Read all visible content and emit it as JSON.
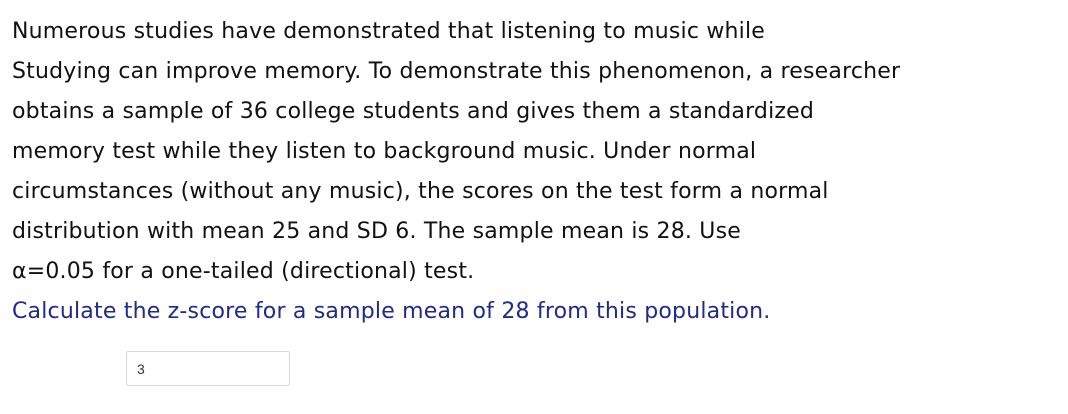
{
  "question": {
    "lines": [
      "Numerous studies have demonstrated that listening to music while",
      "Studying can improve memory. To demonstrate this phenomenon, a researcher",
      "obtains a sample of 36 college students and gives them a standardized",
      "memory test while they listen to background music. Under normal",
      "circumstances (without any music), the scores on the test form a normal",
      "distribution with mean 25 and SD 6. The sample mean is 28. Use",
      "α=0.05 for a one-tailed (directional) test."
    ],
    "prompt": "Calculate the z-score for a sample mean of 28 from this population.",
    "text_color": "#111111",
    "prompt_color": "#1f2a8a"
  },
  "answer": {
    "value": "3"
  }
}
